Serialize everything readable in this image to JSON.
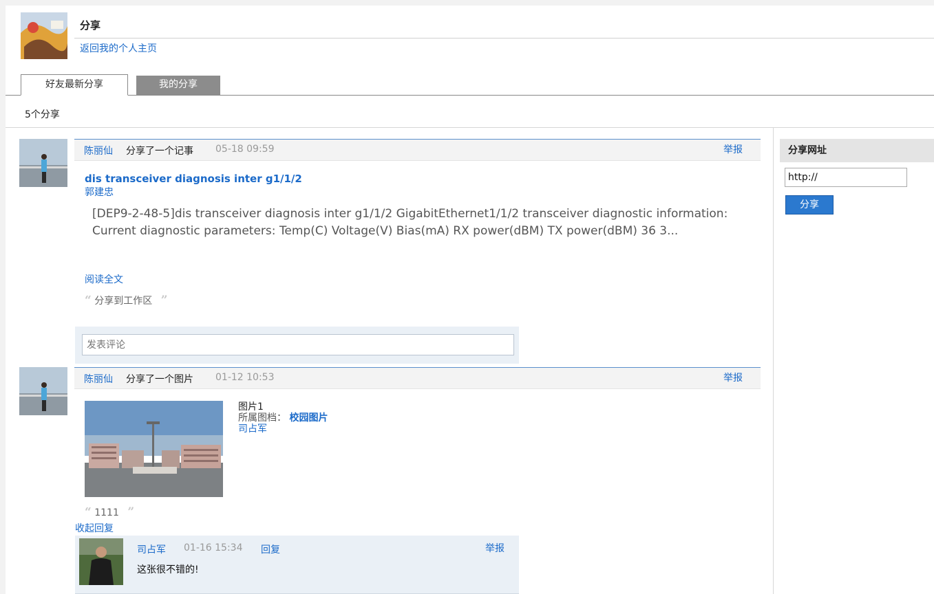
{
  "header": {
    "title": "分享",
    "back_link": "返回我的个人主页"
  },
  "tabs": [
    {
      "label": "好友最新分享",
      "active": true
    },
    {
      "label": "我的分享",
      "active": false
    }
  ],
  "share_count": "5个分享",
  "sidebar": {
    "title": "分享网址",
    "url_value": "http://",
    "share_button": "分享"
  },
  "feed": [
    {
      "user": "陈丽仙",
      "action": "分享了一个记事",
      "time": "05-18 09:59",
      "report": "举报",
      "note_title": "dis transceiver diagnosis inter g1/1/2",
      "author": "郭建忠",
      "body": "[DEP9-2-48-5]dis transceiver diagnosis inter g1/1/2 GigabitEthernet1/1/2 transceiver diagnostic information: Current diagnostic parameters: Temp(C) Voltage(V) Bias(mA) RX power(dBM) TX power(dBM) 36 3...",
      "read_more": "阅读全文",
      "quote": "分享到工作区",
      "comment_placeholder": "发表评论"
    },
    {
      "user": "陈丽仙",
      "action": "分享了一个图片",
      "time": "01-12 10:53",
      "report": "举报",
      "photo_title": "图片1",
      "album_label": "所属图档：",
      "album_name": "校园图片",
      "author": "司占军",
      "quote": "1111",
      "collapse": "收起回复",
      "reply": {
        "user": "司占军",
        "time": "01-16 15:34",
        "reply_link": "回复",
        "report": "举报",
        "text": "这张很不错的!"
      }
    }
  ]
}
